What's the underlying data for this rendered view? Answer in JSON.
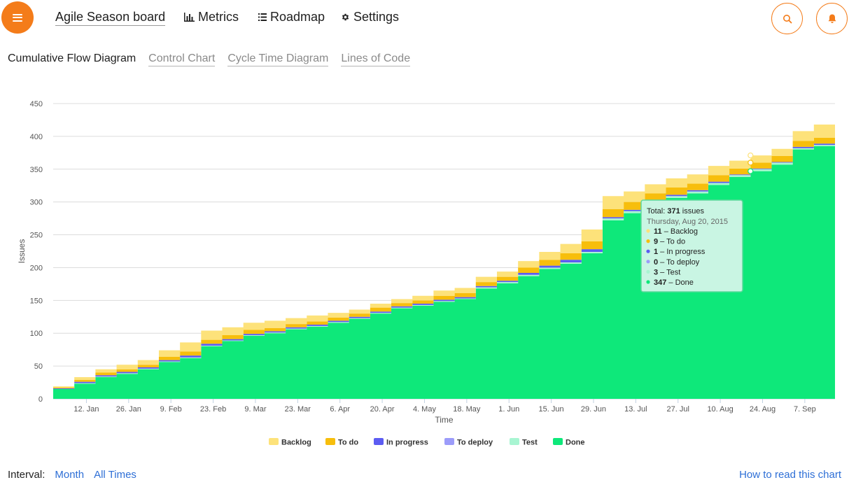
{
  "nav": {
    "board": "Agile Season board",
    "metrics": "Metrics",
    "roadmap": "Roadmap",
    "settings": "Settings"
  },
  "icons": {
    "menu": "hamburger-icon",
    "metrics": "bar-chart-icon",
    "roadmap": "list-icon",
    "settings": "gear-icon",
    "search": "search-icon",
    "notifications": "bell-icon"
  },
  "colors": {
    "accent": "#f47c1a",
    "link": "#2e6fd6"
  },
  "tabs": [
    {
      "label": "Cumulative Flow Diagram",
      "active": true
    },
    {
      "label": "Control Chart",
      "active": false
    },
    {
      "label": "Cycle Time Diagram",
      "active": false
    },
    {
      "label": "Lines of Code",
      "active": false
    }
  ],
  "footer": {
    "interval_label": "Interval:",
    "month": "Month",
    "all_times": "All Times",
    "help": "How to read this chart"
  },
  "chart_data": {
    "type": "area",
    "stacked": true,
    "xlabel": "Time",
    "ylabel": "Issues",
    "ylim": [
      0,
      450
    ],
    "yticks": [
      0,
      50,
      100,
      150,
      200,
      250,
      300,
      350,
      400,
      450
    ],
    "xlim": [
      "2015-01-01",
      "2015-09-17"
    ],
    "xtick_labels": [
      "12. Jan",
      "26. Jan",
      "9. Feb",
      "23. Feb",
      "9. Mar",
      "23. Mar",
      "6. Apr",
      "20. Apr",
      "4. May",
      "18. May",
      "1. Jun",
      "15. Jun",
      "29. Jun",
      "13. Jul",
      "27. Jul",
      "10. Aug",
      "24. Aug",
      "7. Sep"
    ],
    "xtick_dates": [
      "2015-01-12",
      "2015-01-26",
      "2015-02-09",
      "2015-02-23",
      "2015-03-09",
      "2015-03-23",
      "2015-04-06",
      "2015-04-20",
      "2015-05-04",
      "2015-05-18",
      "2015-06-01",
      "2015-06-15",
      "2015-06-29",
      "2015-07-13",
      "2015-07-27",
      "2015-08-10",
      "2015-08-24",
      "2015-09-07"
    ],
    "grid": true,
    "legend_position": "bottom-center",
    "x": [
      "2015-01-01",
      "2015-01-08",
      "2015-01-15",
      "2015-01-22",
      "2015-01-29",
      "2015-02-05",
      "2015-02-12",
      "2015-02-19",
      "2015-02-26",
      "2015-03-05",
      "2015-03-12",
      "2015-03-19",
      "2015-03-26",
      "2015-04-02",
      "2015-04-09",
      "2015-04-16",
      "2015-04-23",
      "2015-04-30",
      "2015-05-07",
      "2015-05-14",
      "2015-05-21",
      "2015-05-28",
      "2015-06-04",
      "2015-06-11",
      "2015-06-18",
      "2015-06-25",
      "2015-07-02",
      "2015-07-09",
      "2015-07-16",
      "2015-07-23",
      "2015-07-30",
      "2015-08-06",
      "2015-08-13",
      "2015-08-20",
      "2015-08-27",
      "2015-09-03",
      "2015-09-10",
      "2015-09-17"
    ],
    "series": [
      {
        "name": "Done",
        "color": "#0ee87a",
        "values": [
          15,
          23,
          33,
          38,
          45,
          56,
          62,
          80,
          88,
          96,
          100,
          106,
          110,
          116,
          122,
          130,
          138,
          142,
          148,
          152,
          168,
          176,
          187,
          198,
          206,
          222,
          272,
          283,
          297,
          306,
          313,
          326,
          338,
          347,
          357,
          380,
          385,
          387
        ]
      },
      {
        "name": "Test",
        "color": "#a8f5d2",
        "values": [
          0,
          1,
          1,
          1,
          1,
          1,
          1,
          1,
          1,
          1,
          1,
          1,
          1,
          1,
          1,
          1,
          1,
          1,
          1,
          1,
          2,
          2,
          2,
          2,
          2,
          2,
          3,
          3,
          3,
          3,
          3,
          3,
          3,
          3,
          3,
          2,
          2,
          1
        ]
      },
      {
        "name": "To deploy",
        "color": "#9c9cfa",
        "values": [
          0,
          0,
          0,
          0,
          0,
          0,
          0,
          0,
          0,
          0,
          0,
          0,
          0,
          0,
          0,
          0,
          0,
          0,
          0,
          0,
          0,
          0,
          0,
          0,
          0,
          0,
          0,
          0,
          0,
          0,
          0,
          0,
          0,
          0,
          0,
          0,
          0,
          0
        ]
      },
      {
        "name": "In progress",
        "color": "#5c5cf2",
        "values": [
          1,
          2,
          2,
          2,
          2,
          2,
          3,
          3,
          2,
          2,
          2,
          2,
          2,
          2,
          2,
          2,
          2,
          2,
          2,
          2,
          2,
          2,
          3,
          3,
          4,
          4,
          2,
          2,
          2,
          2,
          2,
          2,
          1,
          1,
          1,
          2,
          2,
          2
        ]
      },
      {
        "name": "To do",
        "color": "#f7be0c",
        "values": [
          1,
          3,
          4,
          4,
          4,
          5,
          6,
          6,
          6,
          6,
          5,
          5,
          5,
          5,
          5,
          6,
          5,
          5,
          6,
          6,
          6,
          6,
          8,
          9,
          10,
          12,
          12,
          12,
          11,
          11,
          10,
          10,
          9,
          9,
          9,
          9,
          9,
          9
        ]
      },
      {
        "name": "Backlog",
        "color": "#fde27a",
        "values": [
          2,
          4,
          5,
          7,
          7,
          10,
          14,
          14,
          12,
          11,
          11,
          9,
          9,
          7,
          6,
          6,
          6,
          7,
          8,
          8,
          8,
          8,
          10,
          12,
          14,
          18,
          20,
          16,
          14,
          14,
          14,
          14,
          12,
          11,
          11,
          15,
          20,
          21
        ]
      }
    ],
    "tooltip": {
      "total_prefix": "Total: ",
      "total_value": "371",
      "total_suffix": " issues",
      "date": "Thursday, Aug 20, 2015",
      "x": "2015-08-20",
      "rows": [
        {
          "value": "11",
          "label": " – Backlog",
          "color": "#fde27a"
        },
        {
          "value": "9",
          "label": " – To do",
          "color": "#f7be0c"
        },
        {
          "value": "1",
          "label": " – In progress",
          "color": "#5c5cf2"
        },
        {
          "value": "0",
          "label": " – To deploy",
          "color": "#9c9cfa"
        },
        {
          "value": "3",
          "label": " – Test",
          "color": "#a8f5d2"
        },
        {
          "value": "347",
          "label": " – Done",
          "color": "#0ee87a"
        }
      ]
    }
  }
}
